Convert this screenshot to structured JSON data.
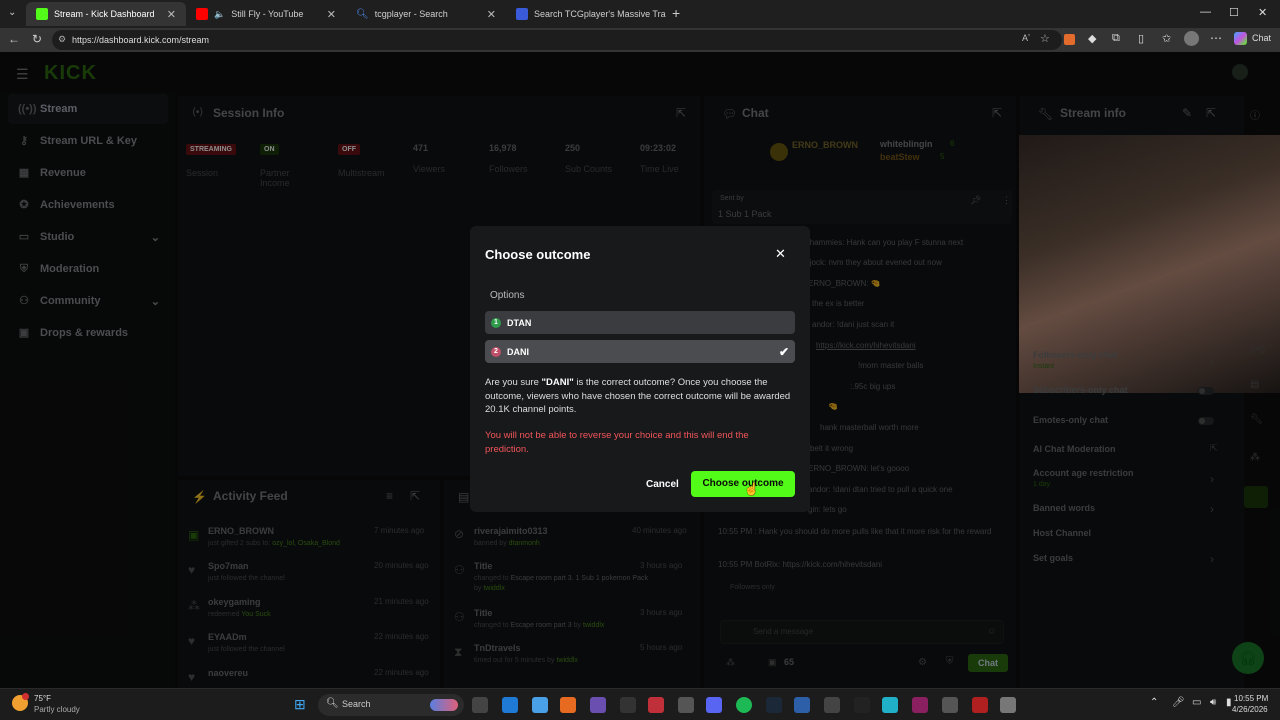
{
  "browser": {
    "tabs": [
      {
        "title": "Stream - Kick Dashboard",
        "color": "#53fc18"
      },
      {
        "title": "Still Fly - YouTube",
        "color": "#ff0000"
      },
      {
        "title": "tcgplayer - Search",
        "color": "#4f8ef7"
      },
      {
        "title": "Search TCGplayer's Massive Tradin",
        "color": "#3a5bd9"
      }
    ],
    "new_tab": "+",
    "url": "https://dashboard.kick.com/stream",
    "chat_button": "Chat"
  },
  "brand": {
    "logo": "KICK",
    "accent": "#53fc18"
  },
  "sidebar": {
    "items": [
      {
        "label": "Stream",
        "icon": "broadcast-icon"
      },
      {
        "label": "Stream URL & Key",
        "icon": "key-icon"
      },
      {
        "label": "Revenue",
        "icon": "revenue-icon"
      },
      {
        "label": "Achievements",
        "icon": "trophy-icon"
      },
      {
        "label": "Studio",
        "icon": "studio-icon"
      },
      {
        "label": "Moderation",
        "icon": "shield-icon"
      },
      {
        "label": "Community",
        "icon": "community-icon"
      },
      {
        "label": "Drops & rewards",
        "icon": "gift-icon"
      }
    ]
  },
  "session": {
    "title": "Session Info",
    "badges": [
      {
        "text": "STREAMING",
        "label": "Session",
        "color": "#c1272d"
      },
      {
        "text": "ON",
        "label": "Partner Income",
        "color": "#2e6b12"
      },
      {
        "text": "OFF",
        "label": "Multistream",
        "color": "#c1272d"
      }
    ],
    "stats": [
      {
        "value": "471",
        "label": "Viewers"
      },
      {
        "value": "16,978",
        "label": "Followers"
      },
      {
        "value": "250",
        "label": "Sub Counts"
      },
      {
        "value": "09:23:02",
        "label": "Time Live"
      }
    ]
  },
  "activity": {
    "title": "Activity Feed",
    "items": [
      {
        "name": "ERNO_BROWN",
        "sub": "just gifted 2 subs to:",
        "extra": "ozy_lol, Osaka_Blond",
        "time": "7 minutes ago"
      },
      {
        "name": "Spo7man",
        "sub": "just followed the channel",
        "extra": "",
        "time": "20 minutes ago"
      },
      {
        "name": "okeygaming",
        "sub": "redeemed",
        "extra": "You Suck",
        "time": "21 minutes ago"
      },
      {
        "name": "EYAADm",
        "sub": "just followed the channel",
        "extra": "",
        "time": "22 minutes ago"
      },
      {
        "name": "naovereu",
        "sub": "",
        "extra": "",
        "time": "22 minutes ago"
      }
    ]
  },
  "modlog": {
    "items": [
      {
        "name": "riverajaimito0313",
        "sub": "banned by",
        "extra": "dtanmonh",
        "time": "40 minutes ago"
      },
      {
        "name": "Title",
        "sub": "changed to",
        "extra": "Escape room part 3. 1 Sub 1 pokemon Pack",
        "by": "twiddlx",
        "time": "3 hours ago"
      },
      {
        "name": "Title",
        "sub": "changed to",
        "extra": "Escape room part 3",
        "by": "twiddlx",
        "time": "3 hours ago"
      },
      {
        "name": "TnDtravels",
        "sub": "timed out for 5 minutes by",
        "extra": "twiddlx",
        "time": "5 hours ago"
      }
    ]
  },
  "chat": {
    "title": "Chat",
    "top_gifters": [
      "ERNO_BROWN",
      "whiteblingin",
      "beatStew"
    ],
    "gifter_counts": [
      "6",
      "5"
    ],
    "pinned": {
      "sent_by": "Sent by",
      "text": "1 Sub 1 Pack"
    },
    "lines": [
      "jhammies: Hank can you play F stunna next",
      "jjock: nvm they about evened out now",
      "ERNO_BROWN: 🤏",
      "the ex is better",
      "andor: !dani just scan it",
      "https://kick.com/hihevitsdani",
      "!mom master balls",
      ":.95c big ups",
      "🤏",
      "hank masterball worth more",
      "belt it wrong",
      "ERNO_BROWN: let's goooo",
      "andor: !dani dtan tried to pull a quick one",
      "gin: lets go",
      "10:55 PM : Hank you should do more pulls like that it more risk for the reward",
      "10:55 PM BotRix: https://kick.com/hihevitsdani"
    ],
    "followers_only": "Followers only",
    "input_placeholder": "Send a message",
    "count": "65",
    "send": "Chat"
  },
  "stream_info": {
    "title": "Stream info",
    "rows": [
      {
        "label": "Followers-only chat",
        "sub": "Instant"
      },
      {
        "label": "Subscribers-only chat",
        "sub": ""
      },
      {
        "label": "Emotes-only chat",
        "sub": ""
      },
      {
        "label": "AI Chat Moderation",
        "sub": ""
      },
      {
        "label": "Account age restriction",
        "sub": "1 day"
      },
      {
        "label": "Banned words",
        "sub": ""
      },
      {
        "label": "Host Channel",
        "sub": ""
      },
      {
        "label": "Set goals",
        "sub": ""
      }
    ]
  },
  "modal": {
    "title": "Choose outcome",
    "options_label": "Options",
    "options": [
      {
        "num": "1",
        "label": "DTAN",
        "color": "#2e9c4a"
      },
      {
        "num": "2",
        "label": "DANI",
        "color": "#c0506a"
      }
    ],
    "confirm_text_1": "Are you sure ",
    "confirm_bold": "\"DANI\"",
    "confirm_text_2": " is the correct outcome? Once you choose the outcome, viewers who have chosen the correct outcome will be awarded 20.1K channel points.",
    "warning": "You will not be able to reverse your choice and this will end the prediction.",
    "warning_color": "#f2555a",
    "cancel": "Cancel",
    "confirm": "Choose outcome"
  },
  "taskbar": {
    "weather_temp": "75°F",
    "weather_desc": "Partly cloudy",
    "search": "Search",
    "time": "10:55 PM",
    "date": "4/26/2026"
  }
}
